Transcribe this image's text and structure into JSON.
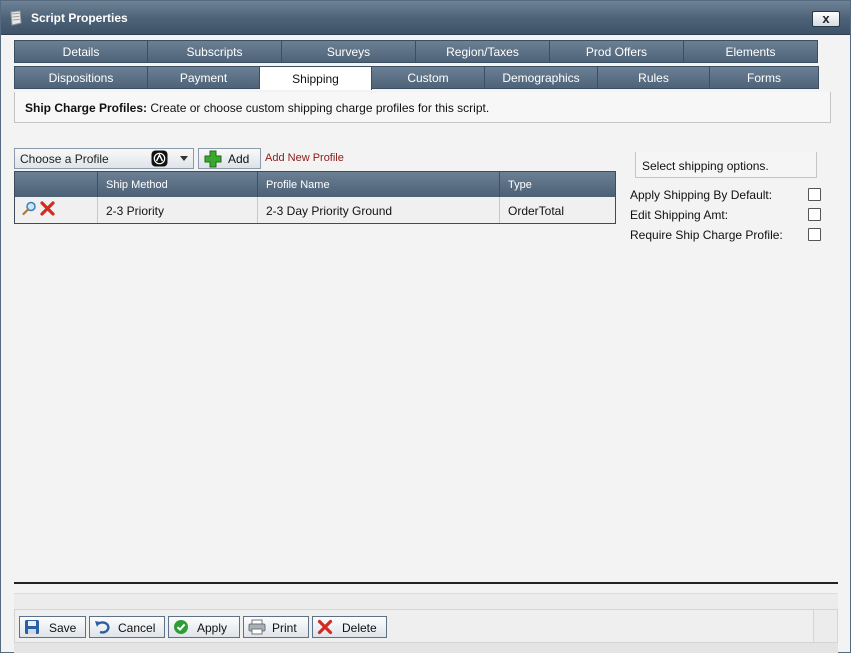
{
  "window": {
    "title": "Script Properties",
    "close_label": "x"
  },
  "tabs_row1": [
    {
      "label": "Details"
    },
    {
      "label": "Subscripts"
    },
    {
      "label": "Surveys"
    },
    {
      "label": "Region/Taxes"
    },
    {
      "label": "Prod Offers"
    },
    {
      "label": "Elements"
    }
  ],
  "tabs_row2": [
    {
      "label": "Dispositions"
    },
    {
      "label": "Payment"
    },
    {
      "label": "Shipping"
    },
    {
      "label": "Custom"
    },
    {
      "label": "Demographics"
    },
    {
      "label": "Rules"
    },
    {
      "label": "Forms"
    }
  ],
  "active_tab": "Shipping",
  "description": {
    "heading": "Ship Charge Profiles:",
    "text": " Create or choose custom shipping charge profiles for this script."
  },
  "profile_select": {
    "value": "Choose a Profile"
  },
  "add_button": {
    "label": "Add"
  },
  "add_new_profile_link": "Add New Profile",
  "grid": {
    "columns": [
      "",
      "Ship Method",
      "Profile Name",
      "Type"
    ],
    "rows": [
      {
        "ship_method": "2-3 Priority",
        "profile_name": "2-3 Day Priority Ground",
        "type": "OrderTotal"
      }
    ]
  },
  "shipping_options": {
    "header": "Select shipping options.",
    "items": [
      {
        "label": "Apply Shipping By Default:",
        "checked": false
      },
      {
        "label": "Edit Shipping Amt:",
        "checked": false
      },
      {
        "label": "Require Ship Charge Profile:",
        "checked": false
      }
    ]
  },
  "footer_buttons": {
    "save": "Save",
    "cancel": "Cancel",
    "apply": "Apply",
    "print": "Print",
    "delete": "Delete"
  },
  "colors": {
    "titlebar": "#4d6176",
    "tab": "#5b7085",
    "link": "#8b1a1a",
    "delete_red": "#d22b1f",
    "add_green": "#3aa82c"
  }
}
